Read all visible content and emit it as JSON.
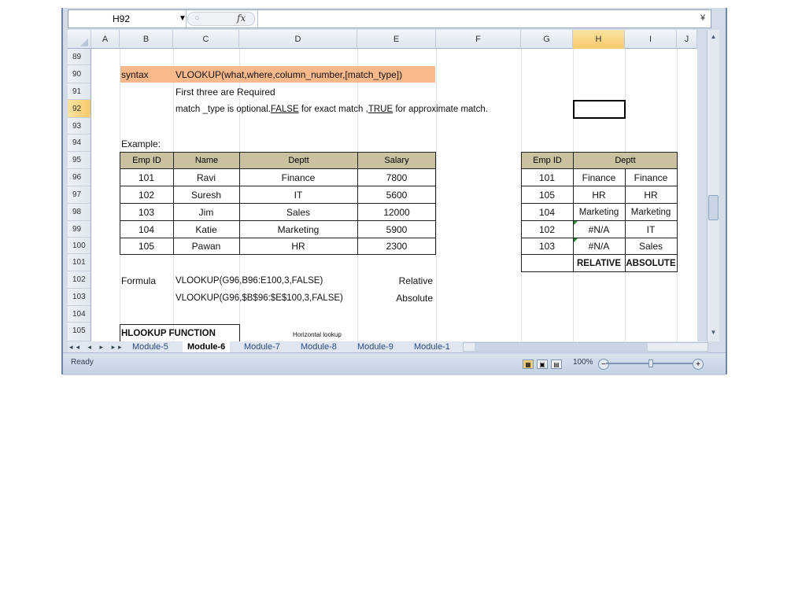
{
  "formula_bar": {
    "name_box": "H92",
    "fx_label": "fx",
    "circle_label": "○"
  },
  "columns": [
    "A",
    "B",
    "C",
    "D",
    "E",
    "F",
    "G",
    "H",
    "I",
    "J"
  ],
  "rows": [
    "89",
    "90",
    "91",
    "92",
    "93",
    "94",
    "95",
    "96",
    "97",
    "98",
    "99",
    "100",
    "101",
    "102",
    "103",
    "104",
    "105"
  ],
  "selected_cell": "H92",
  "cells": {
    "syntax_label": "syntax",
    "syntax_formula": "VLOOKUP(what,where,column_number,[match_type])",
    "required_note": "First three are Required",
    "match_note_pre": "match _type is optional.",
    "match_note_false": "FALSE",
    "match_note_mid": " for exact match ,",
    "match_note_true": "TRUE",
    "match_note_post": " for approximate match.",
    "example_label": "Example:",
    "formula_label": "Formula",
    "formula_relative": "VLOOKUP(G96,B96:E100,3,FALSE)",
    "relative_label": "Relative",
    "formula_absolute": "VLOOKUP(G96,$B$96:$E$100,3,FALSE)",
    "absolute_label": "Absolute",
    "hlookup_label": "HLOOKUP FUNCTION",
    "horizontal_label": "Horizontal lookup"
  },
  "left_table": {
    "headers": [
      "Emp ID",
      "Name",
      "Deptt",
      "Salary"
    ],
    "rows": [
      [
        "101",
        "Ravi",
        "Finance",
        "7800"
      ],
      [
        "102",
        "Suresh",
        "IT",
        "5600"
      ],
      [
        "103",
        "Jim",
        "Sales",
        "12000"
      ],
      [
        "104",
        "Katie",
        "Marketing",
        "5900"
      ],
      [
        "105",
        "Pawan",
        "HR",
        "2300"
      ]
    ]
  },
  "right_table": {
    "headers": [
      "Emp ID",
      "Deptt"
    ],
    "rows": [
      [
        "101",
        "Finance",
        "Finance"
      ],
      [
        "105",
        "HR",
        "HR"
      ],
      [
        "104",
        "Marketing",
        "Marketing"
      ],
      [
        "102",
        "#N/A",
        "IT"
      ],
      [
        "103",
        "#N/A",
        "Sales"
      ]
    ],
    "footer": [
      "RELATIVE",
      "ABSOLUTE"
    ]
  },
  "sheet_tabs": [
    "Module-5",
    "Module-6",
    "Module-7",
    "Module-8",
    "Module-9",
    "Module-1"
  ],
  "active_tab": "Module-6",
  "tab_nav": "◂◂ ◂ ▸ ▸▸",
  "status": {
    "ready": "Ready",
    "zoom": "100%"
  },
  "colors": {
    "accent_orange": "#f9b98b",
    "header_khaki": "#c9c1a0",
    "selection": "#f6c96a"
  }
}
